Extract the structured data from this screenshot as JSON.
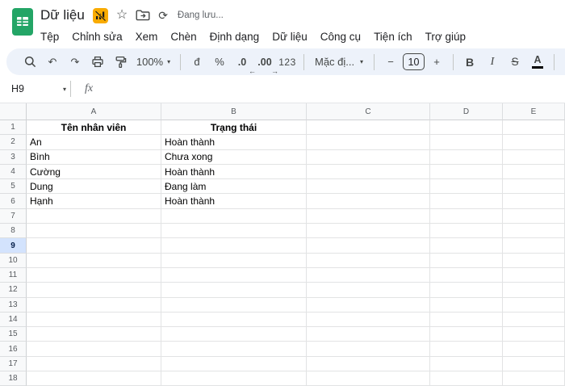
{
  "header": {
    "title": "Dữ liệu",
    "status": "Đang lưu...",
    "menus": [
      "Tệp",
      "Chỉnh sửa",
      "Xem",
      "Chèn",
      "Định dạng",
      "Dữ liệu",
      "Công cụ",
      "Tiện ích",
      "Trợ giúp"
    ]
  },
  "icons": {
    "star": "☆",
    "sync": "⟳",
    "undo": "↶",
    "redo": "↷",
    "caret": "▾"
  },
  "toolbar": {
    "zoom_level": "100%",
    "currency": "đ",
    "percent": "%",
    "decrease_decimal": ".0",
    "decrease_arrow": "←",
    "increase_decimal": ".00",
    "increase_arrow": "→",
    "more_formats": "123",
    "font_name": "Mặc đị...",
    "minus": "−",
    "font_size": "10",
    "plus": "+",
    "bold": "B",
    "italic": "I",
    "strikethrough": "S",
    "text_color": "A"
  },
  "formula_bar": {
    "cell_ref": "H9",
    "fx_label": "fx"
  },
  "grid": {
    "columns": [
      "A",
      "B",
      "C",
      "D",
      "E"
    ],
    "selected_row": 9,
    "rows": [
      {
        "n": "1",
        "a": "Tên nhân viên",
        "b": "Trạng thái",
        "header": true
      },
      {
        "n": "2",
        "a": "An",
        "b": "Hoàn thành"
      },
      {
        "n": "3",
        "a": "Bình",
        "b": "Chưa xong"
      },
      {
        "n": "4",
        "a": "Cường",
        "b": "Hoàn thành"
      },
      {
        "n": "5",
        "a": "Dung",
        "b": "Đang làm"
      },
      {
        "n": "6",
        "a": "Hạnh",
        "b": "Hoàn thành"
      },
      {
        "n": "7",
        "a": "",
        "b": ""
      },
      {
        "n": "8",
        "a": "",
        "b": ""
      },
      {
        "n": "9",
        "a": "",
        "b": ""
      },
      {
        "n": "10",
        "a": "",
        "b": ""
      },
      {
        "n": "11",
        "a": "",
        "b": ""
      },
      {
        "n": "12",
        "a": "",
        "b": ""
      },
      {
        "n": "13",
        "a": "",
        "b": ""
      },
      {
        "n": "14",
        "a": "",
        "b": ""
      },
      {
        "n": "15",
        "a": "",
        "b": ""
      },
      {
        "n": "16",
        "a": "",
        "b": ""
      },
      {
        "n": "17",
        "a": "",
        "b": ""
      },
      {
        "n": "18",
        "a": "",
        "b": ""
      }
    ]
  },
  "colors": {
    "logo_green": "#23a566",
    "badge_yellow": "#f9ab00",
    "toolbar_bg": "#edf2fa",
    "selected_row_bg": "#d3e3fd",
    "selected_row_text": "#041e49",
    "icon_gray": "#444746"
  }
}
